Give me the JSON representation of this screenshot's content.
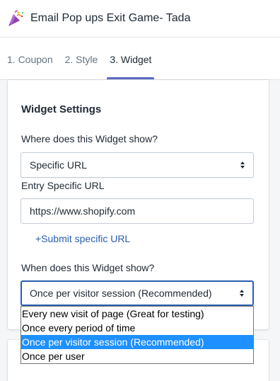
{
  "header": {
    "title": "Email Pop ups Exit Game- Tada",
    "icon": "party-popper-icon"
  },
  "tabs": [
    {
      "label": "1. Coupon",
      "active": false
    },
    {
      "label": "2. Style",
      "active": false
    },
    {
      "label": "3. Widget",
      "active": true
    }
  ],
  "widget_settings": {
    "title": "Widget Settings",
    "where_label": "Where does this Widget show?",
    "where_value": "Specific URL",
    "entry_label": "Entry Specific URL",
    "entry_value": "https://www.shopify.com",
    "submit_link": "+Submit specific URL",
    "when_label": "When does this Widget show?",
    "when_value": "Once per visitor session (Recommended)",
    "when_options": [
      "Every new visit of page (Great for testing)",
      "Once every period of time",
      "Once per visitor session (Recommended)",
      "Once per user"
    ],
    "when_selected_index": 2
  },
  "colors": {
    "accent": "#5c6ac4",
    "link": "#2a5db0",
    "highlight": "#1e90ff"
  }
}
